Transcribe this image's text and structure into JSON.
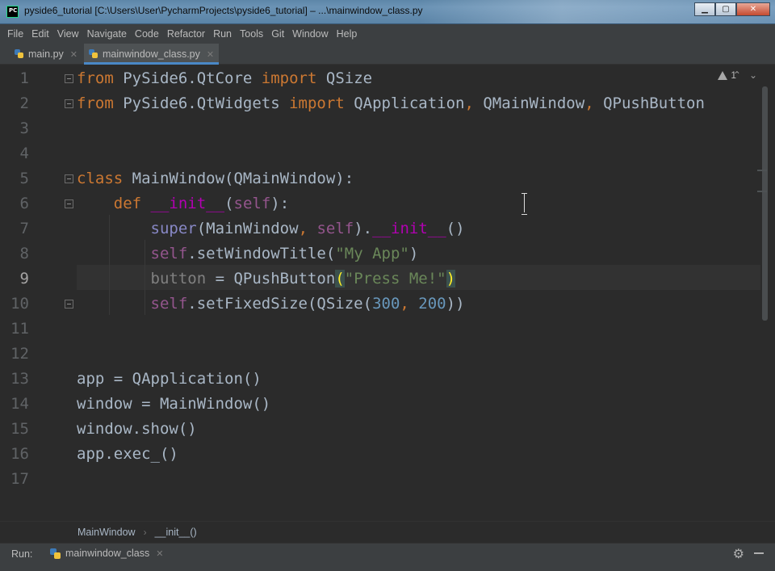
{
  "window": {
    "title": "pyside6_tutorial [C:\\Users\\User\\PycharmProjects\\pyside6_tutorial] – ...\\mainwindow_class.py",
    "app_icon_text": "PC",
    "controls": {
      "minimize": "▁",
      "maximize": "▢",
      "close": "✕"
    }
  },
  "menu": [
    "File",
    "Edit",
    "View",
    "Navigate",
    "Code",
    "Refactor",
    "Run",
    "Tools",
    "Git",
    "Window",
    "Help"
  ],
  "tabs": [
    {
      "label": "main.py",
      "close": "✕",
      "active": false
    },
    {
      "label": "mainwindow_class.py",
      "close": "✕",
      "active": true
    }
  ],
  "editor": {
    "inspection_count": "1",
    "line_numbers": [
      "1",
      "2",
      "3",
      "4",
      "5",
      "6",
      "7",
      "8",
      "9",
      "10",
      "11",
      "12",
      "13",
      "14",
      "15",
      "16",
      "17"
    ],
    "current_line": "9",
    "lines": [
      [
        [
          "kw",
          "from"
        ],
        [
          "plain",
          " PySide6.QtCore "
        ],
        [
          "kw",
          "import"
        ],
        [
          "plain",
          " QSize"
        ]
      ],
      [
        [
          "kw",
          "from"
        ],
        [
          "plain",
          " PySide6.QtWidgets "
        ],
        [
          "kw",
          "import"
        ],
        [
          "plain",
          " QApplication"
        ],
        [
          "kw",
          ","
        ],
        [
          "plain",
          " QMainWindow"
        ],
        [
          "kw",
          ","
        ],
        [
          "plain",
          " QPushButton"
        ]
      ],
      [],
      [],
      [
        [
          "kw",
          "class"
        ],
        [
          "plain",
          " MainWindow(QMainWindow):"
        ]
      ],
      [
        [
          "plain",
          "    "
        ],
        [
          "kw",
          "def"
        ],
        [
          "plain",
          " "
        ],
        [
          "dunder",
          "__init__"
        ],
        [
          "plain",
          "("
        ],
        [
          "self",
          "self"
        ],
        [
          "plain",
          "):"
        ]
      ],
      [
        [
          "plain",
          "        "
        ],
        [
          "builtin",
          "super"
        ],
        [
          "plain",
          "(MainWindow"
        ],
        [
          "kw",
          ","
        ],
        [
          "plain",
          " "
        ],
        [
          "self",
          "self"
        ],
        [
          "plain",
          ")."
        ],
        [
          "dunder",
          "__init__"
        ],
        [
          "plain",
          "()"
        ]
      ],
      [
        [
          "plain",
          "        "
        ],
        [
          "self",
          "self"
        ],
        [
          "plain",
          ".setWindowTitle("
        ],
        [
          "str",
          "\"My App\""
        ],
        [
          "plain",
          ")"
        ]
      ],
      [
        [
          "plain",
          "        "
        ],
        [
          "unused",
          "button"
        ],
        [
          "plain",
          " = QPushButton"
        ],
        [
          "bracket-match",
          "("
        ],
        [
          "str",
          "\"Press Me!\""
        ],
        [
          "bracket-match",
          ")"
        ]
      ],
      [
        [
          "plain",
          "        "
        ],
        [
          "self",
          "self"
        ],
        [
          "plain",
          ".setFixedSize(QSize("
        ],
        [
          "num",
          "300"
        ],
        [
          "kw",
          ","
        ],
        [
          "plain",
          " "
        ],
        [
          "num",
          "200"
        ],
        [
          "plain",
          "))"
        ]
      ],
      [],
      [],
      [
        [
          "plain",
          "app = QApplication()"
        ]
      ],
      [
        [
          "plain",
          "window = MainWindow()"
        ]
      ],
      [
        [
          "plain",
          "window.show()"
        ]
      ],
      [
        [
          "plain",
          "app.exec_()"
        ]
      ],
      []
    ]
  },
  "breadcrumb": [
    "MainWindow",
    "__init__()"
  ],
  "run_panel": {
    "label": "Run:",
    "tab": "mainwindow_class",
    "close": "✕"
  },
  "colors": {
    "keyword": "#cc7832",
    "self": "#94558d",
    "dunder": "#b200b2",
    "string": "#6a8759",
    "number": "#6897bb",
    "text": "#a9b7c6",
    "background": "#2b2b2b"
  }
}
